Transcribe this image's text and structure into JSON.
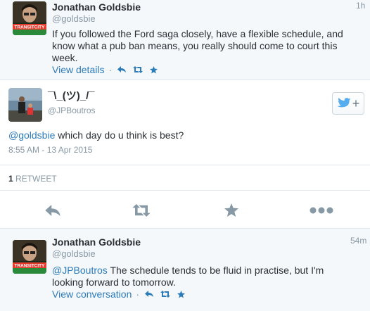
{
  "tweet1": {
    "name": "Jonathan Goldsbie",
    "handle": "@goldsbie",
    "time": "1h",
    "text": "If you followed the Ford saga closely, have a flexible schedule, and know what a pub ban means, you really should come to court this week.",
    "view_label": "View details",
    "avatar_caption": "TRANSITCITY"
  },
  "focus": {
    "name": "¯\\_(ツ)_/¯",
    "handle": "@JPBoutros",
    "mention": "@goldsbie",
    "text": " which day do u think is best?",
    "timestamp": "8:55 AM - 13 Apr 2015",
    "retweet_count": "1",
    "retweet_label": "RETWEET"
  },
  "tweet2": {
    "name": "Jonathan Goldsbie",
    "handle": "@goldsbie",
    "time": "54m",
    "mention": "@JPBoutros",
    "text": " The schedule tends to be fluid in practise, but I'm looking forward to tomorrow.",
    "view_label": "View conversation",
    "avatar_caption": "TRANSITCITY"
  },
  "colors": {
    "link": "#2b7bb9",
    "meta": "#8899a6",
    "icon_gray": "#8899a6",
    "twitter_blue": "#55acee"
  },
  "icons": [
    "reply-icon",
    "retweet-icon",
    "favorite-icon",
    "more-icon",
    "follow-bird-icon"
  ]
}
